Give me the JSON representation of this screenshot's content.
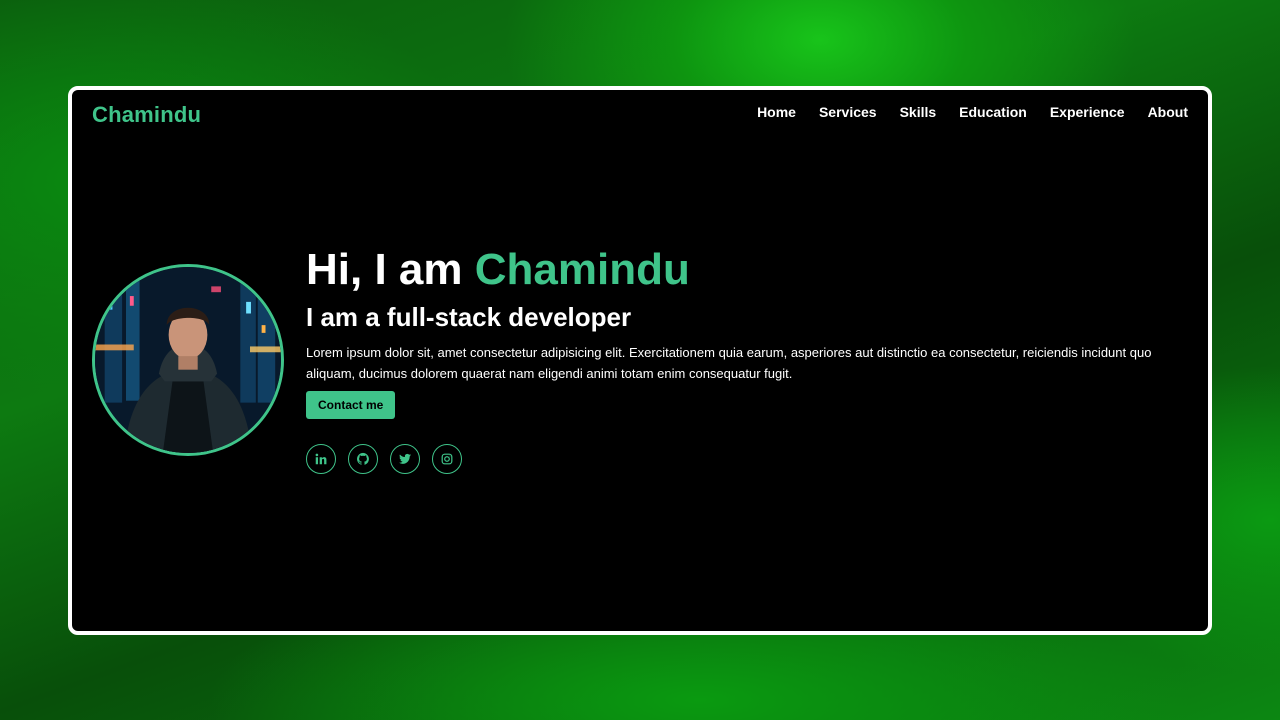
{
  "colors": {
    "accent": "#3fc48a",
    "background": "#000000",
    "frame": "#ffffff"
  },
  "brand": {
    "name": "Chamindu"
  },
  "nav": {
    "items": [
      {
        "label": "Home"
      },
      {
        "label": "Services"
      },
      {
        "label": "Skills"
      },
      {
        "label": "Education"
      },
      {
        "label": "Experience"
      },
      {
        "label": "About"
      }
    ]
  },
  "hero": {
    "greeting": "Hi, I am ",
    "name": "Chamindu",
    "subtitle": "I am a full-stack developer",
    "description": "Lorem ipsum dolor sit, amet consectetur adipisicing elit. Exercitationem quia earum, asperiores aut distinctio ea consectetur, reiciendis incidunt quo aliquam, ducimus dolorem quaerat nam eligendi animi totam enim consequatur fugit.",
    "cta_label": "Contact me"
  },
  "socials": [
    {
      "icon": "linkedin-icon"
    },
    {
      "icon": "github-icon"
    },
    {
      "icon": "twitter-icon"
    },
    {
      "icon": "instagram-icon"
    }
  ]
}
